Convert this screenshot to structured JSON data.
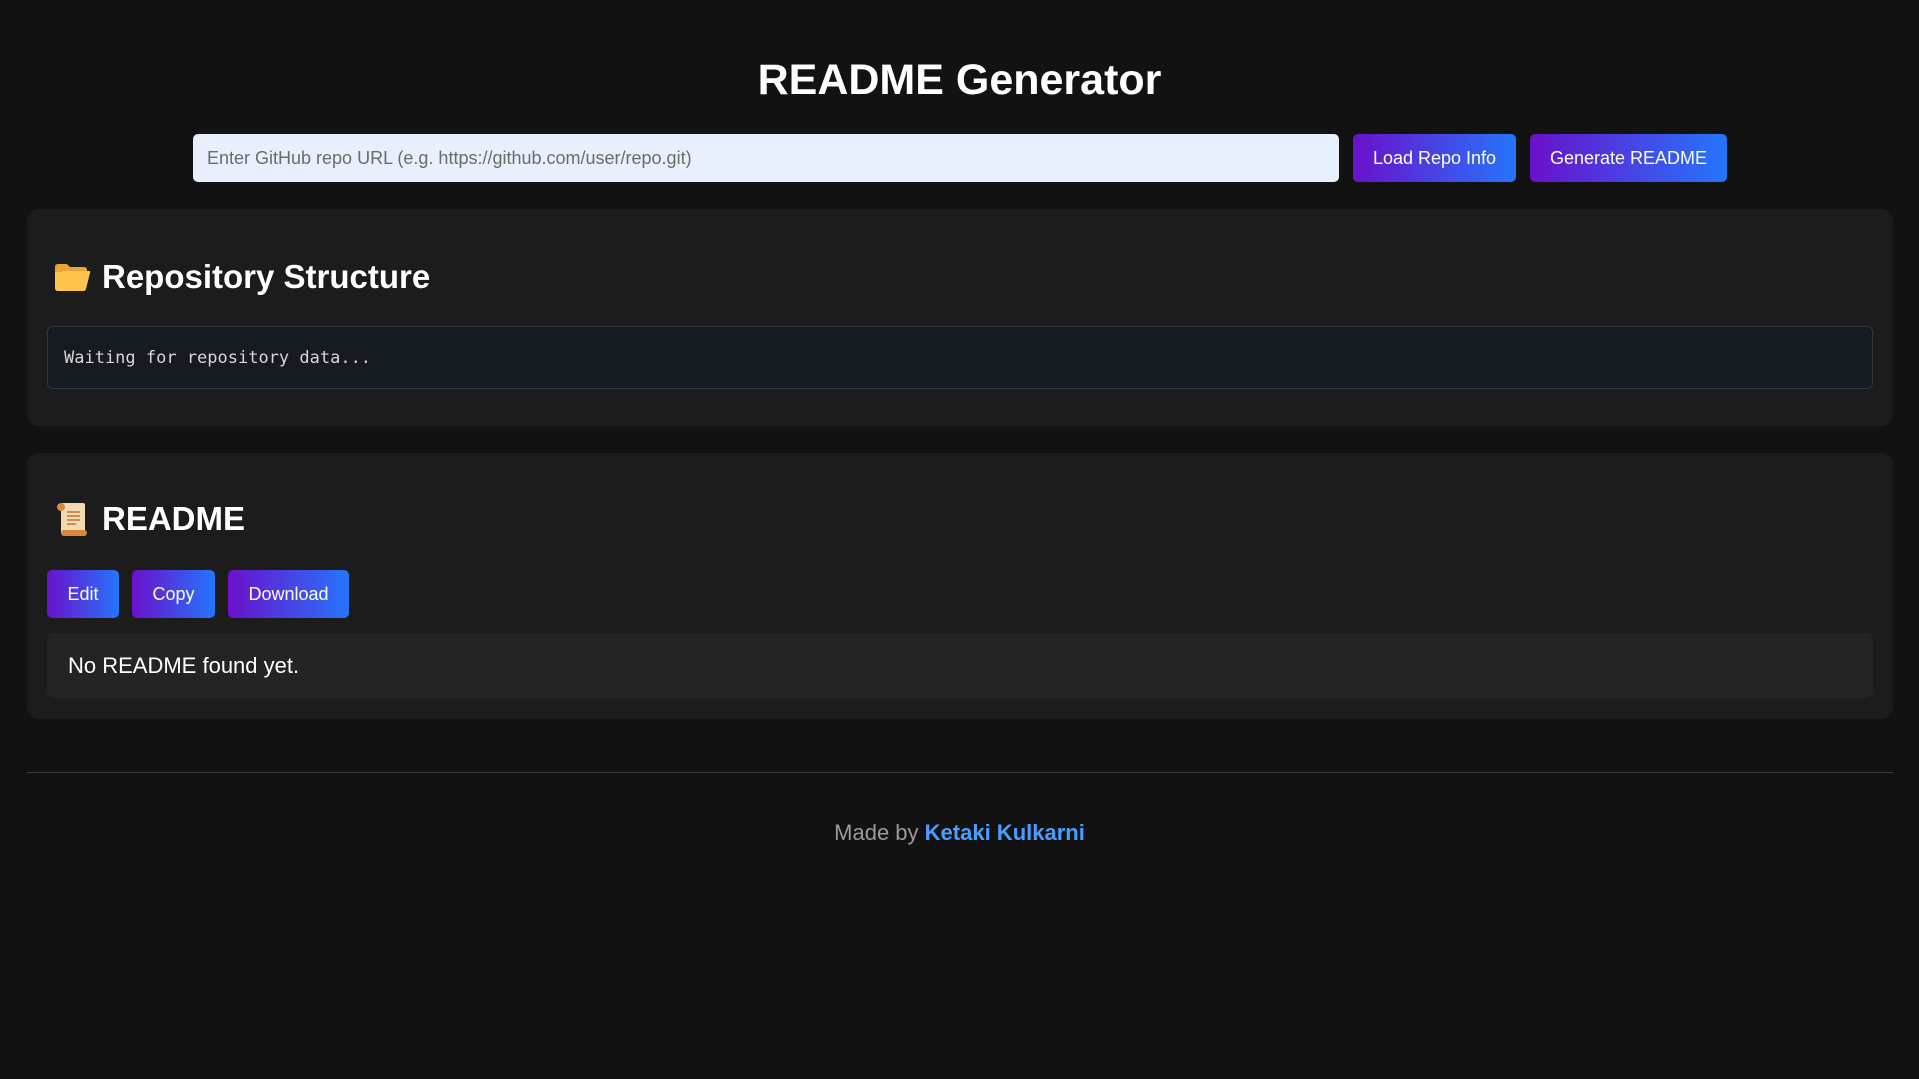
{
  "header": {
    "title": "README Generator"
  },
  "repo_input": {
    "placeholder": "Enter GitHub repo URL (e.g. https://github.com/user/repo.git)",
    "value": ""
  },
  "actions": {
    "load_label": "Load Repo Info",
    "generate_label": "Generate README"
  },
  "structure_section": {
    "icon": "folder-open-icon",
    "title": "Repository Structure",
    "content": "Waiting for repository data..."
  },
  "readme_section": {
    "icon": "scroll-icon",
    "title": "README",
    "buttons": {
      "edit": "Edit",
      "copy": "Copy",
      "download": "Download"
    },
    "content": "No README found yet."
  },
  "footer": {
    "prefix": "Made by",
    "author": "Ketaki Kulkarni"
  },
  "colors": {
    "background": "#121212",
    "card": "#1c1c1c",
    "button_gradient_start": "#6a11cb",
    "button_gradient_end": "#2575fc",
    "link": "#4a9eff"
  }
}
